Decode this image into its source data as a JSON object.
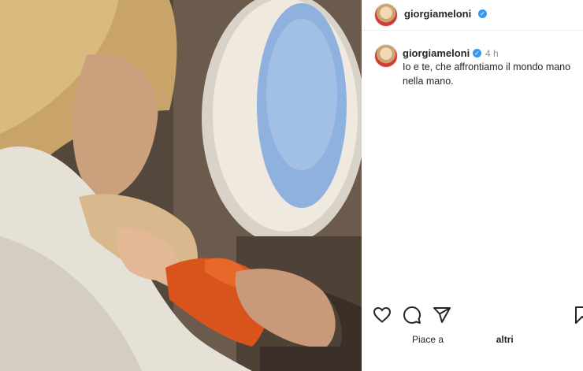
{
  "header": {
    "username": "giorgiameloni"
  },
  "post": {
    "username": "giorgiameloni",
    "time": "4 h",
    "caption_line1": "Io e te, che affrontiamo il mondo mano",
    "caption_line2": "nella mano."
  },
  "likes": {
    "prefix": "Piace a",
    "suffix": "altri"
  },
  "icons": [
    "heart-icon",
    "comment-icon",
    "share-icon",
    "bookmark-icon",
    "verified-icon"
  ],
  "colors": {
    "verified": "#3897f0",
    "text": "#262626",
    "muted": "#8e8e8e"
  }
}
